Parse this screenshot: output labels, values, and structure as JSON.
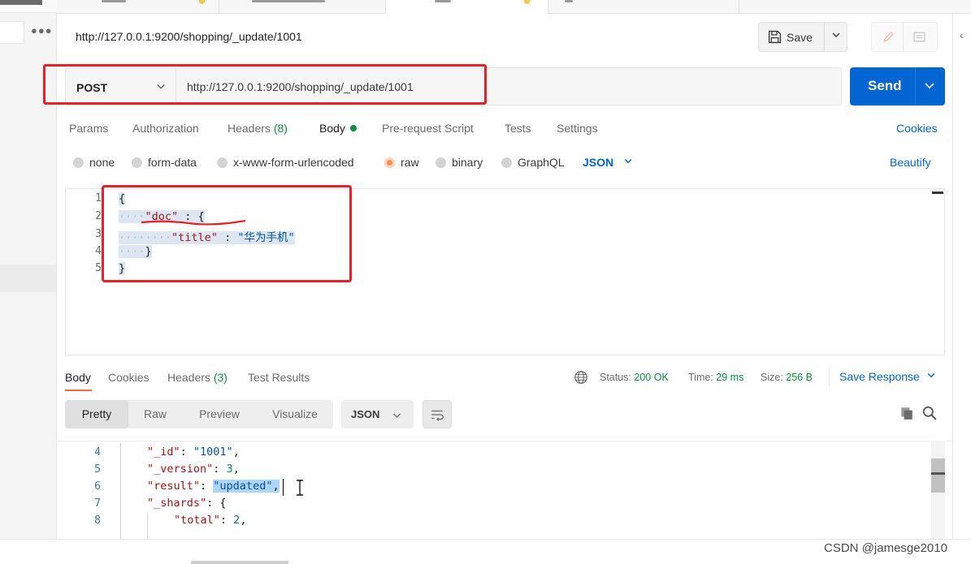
{
  "request": {
    "title": "http://127.0.0.1:9200/shopping/_update/1001",
    "method": "POST",
    "url": "http://127.0.0.1:9200/shopping/_update/1001",
    "save_label": "Save",
    "send_label": "Send"
  },
  "request_tabs": {
    "params": "Params",
    "authorization": "Authorization",
    "headers": "Headers",
    "headers_count": "(8)",
    "body": "Body",
    "prerequest": "Pre-request Script",
    "tests": "Tests",
    "settings": "Settings",
    "cookies": "Cookies"
  },
  "body_types": {
    "none": "none",
    "form_data": "form-data",
    "urlencoded": "x-www-form-urlencoded",
    "raw": "raw",
    "binary": "binary",
    "graphql": "GraphQL",
    "format": "JSON",
    "beautify": "Beautify",
    "selected": "raw"
  },
  "editor": {
    "line_numbers": [
      "1",
      "2",
      "3",
      "4",
      "5"
    ],
    "key_doc": "\"doc\"",
    "key_title": "\"title\"",
    "value_title": "\"华为手机\""
  },
  "response_tabs": {
    "body": "Body",
    "cookies": "Cookies",
    "headers": "Headers",
    "headers_count": "(3)",
    "test_results": "Test Results"
  },
  "response_meta": {
    "status_label": "Status:",
    "status_value": "200 OK",
    "time_label": "Time:",
    "time_value": "29 ms",
    "size_label": "Size:",
    "size_value": "256 B",
    "save_response": "Save Response"
  },
  "response_view": {
    "pretty": "Pretty",
    "raw": "Raw",
    "preview": "Preview",
    "visualize": "Visualize",
    "format": "JSON",
    "active": "Pretty"
  },
  "response_code": {
    "line_numbers": [
      "4",
      "5",
      "6",
      "7",
      "8"
    ],
    "id_key": "\"_id\"",
    "id_value": "\"1001\"",
    "version_key": "\"_version\"",
    "version_value": "3",
    "result_key": "\"result\"",
    "result_value": "\"updated\"",
    "shards_key": "\"_shards\"",
    "total_key": "\"total\"",
    "total_value": "2"
  },
  "watermark": "CSDN @jamesge2010",
  "colors": {
    "accent_blue": "#0265d2",
    "success_green": "#0a8f3f",
    "annotation_red": "#e8202a",
    "active_tab_orange": "#f26b3a"
  },
  "icons": [
    "save-icon",
    "chevron-down-icon",
    "pencil-icon",
    "comment-icon",
    "globe-icon",
    "wrap-icon",
    "copy-icon",
    "search-icon",
    "more-icon",
    "collapse-icon"
  ]
}
